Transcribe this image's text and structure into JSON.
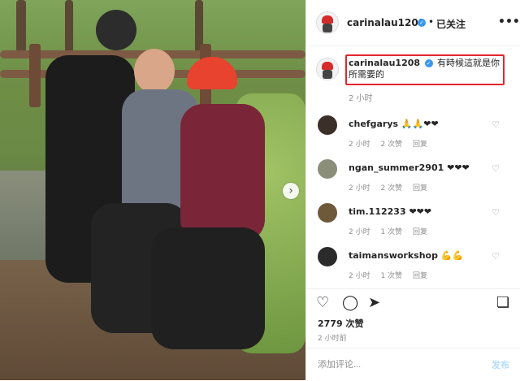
{
  "colors": {
    "brand_blue": "#3897f0",
    "highlight_red": "#e3262f",
    "text": "#262626",
    "muted": "#8e8e8e"
  },
  "photo": {
    "next_icon": "chevron-right-icon",
    "next_glyph": "›"
  },
  "header": {
    "username": "carinalau1208",
    "verified": "✓",
    "dot": "•",
    "follow_label": "已关注",
    "more_label": "•••"
  },
  "caption": {
    "username": "carinalau1208",
    "text": "有時候這就是你所需要的",
    "time": "2 小时"
  },
  "comments": [
    {
      "user": "chefgarys",
      "emoji": "🙏🙏❤❤",
      "time": "2 小时",
      "likes": "2 次赞",
      "reply": "回复",
      "avatar_color": "#3b2f2a"
    },
    {
      "user": "ngan_summer2901",
      "emoji": "❤❤❤",
      "time": "2 小时",
      "likes": "2 次赞",
      "reply": "回复",
      "avatar_color": "#8b8f7a"
    },
    {
      "user": "tim.112233",
      "emoji": "❤❤❤",
      "time": "2 小时",
      "likes": "1 次赞",
      "reply": "回复",
      "avatar_color": "#6e5a3b"
    },
    {
      "user": "taimansworkshop",
      "emoji": "💪💪",
      "time": "2 小时",
      "likes": "1 次赞",
      "reply": "回复",
      "avatar_color": "#2b2b2b"
    }
  ],
  "actions": {
    "heart_icon": "♡",
    "comment_icon": "◯",
    "share_icon": "➤",
    "save_icon": "❏",
    "likes_text": "2779 次赞",
    "time_ago": "2 小时前"
  },
  "add_comment": {
    "placeholder": "添加评论...",
    "post_label": "发布"
  }
}
